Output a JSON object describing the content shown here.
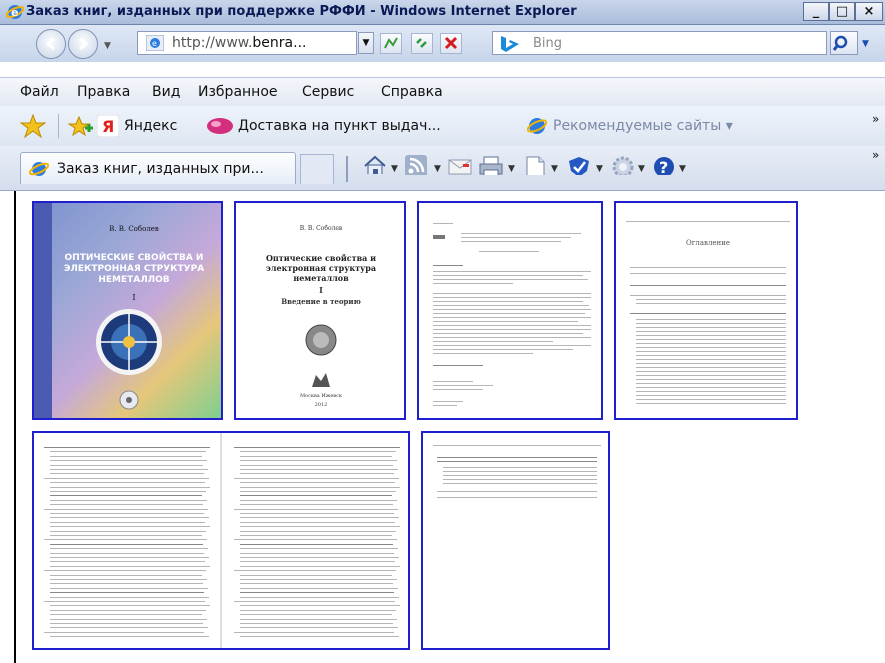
{
  "window": {
    "title": "Заказ книг, изданных при поддержке РФФИ - Windows Internet Explorer",
    "minimize": "_",
    "maximize": "□",
    "close": "×"
  },
  "address": {
    "url_prefix": "http://www.",
    "url_bold": "benra...",
    "search_placeholder": "Bing",
    "search_engine_icon": "bing-logo"
  },
  "menu": [
    "Файл",
    "Правка",
    "Вид",
    "Избранное",
    "Сервис",
    "Справка"
  ],
  "favorites": {
    "yandex": "Яндекс",
    "delivery": "Доставка на пункт выдач...",
    "recommended": "Рекомендуемые сайты ▾",
    "more": "»"
  },
  "tab": {
    "title": "Заказ книг, изданных при..."
  },
  "command_more": "»",
  "book": {
    "cover_author": "В. В. Соболев",
    "cover_title": "ОПТИЧЕСКИЕ СВОЙСТВА И ЭЛЕКТРОННАЯ СТРУКТУРА НЕМЕТАЛЛОВ",
    "cover_volume": "I",
    "title_author": "В. В. Соболев",
    "title_text": "Оптические свойства и электронная структура неметаллов",
    "title_volume": "I",
    "title_subtitle": "Введение в теорию",
    "title_city": "Москва  Ижевск",
    "title_year": "2012",
    "toc_heading": "Оглавление"
  },
  "colors": {
    "page_border": "#1f1fd0",
    "title_bar": "#b7c7e2",
    "cover_blue": "#3a4fa8"
  }
}
